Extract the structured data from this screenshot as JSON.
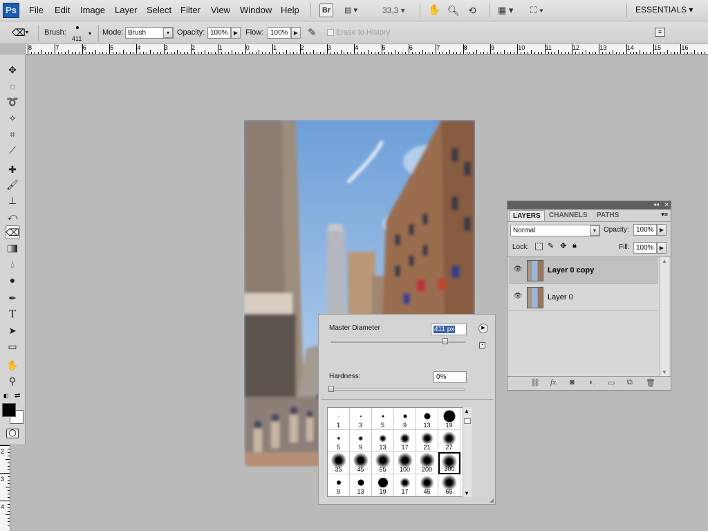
{
  "menubar": {
    "logo": "Ps",
    "items": [
      "File",
      "Edit",
      "Image",
      "Layer",
      "Select",
      "Filter",
      "View",
      "Window",
      "Help"
    ],
    "bridge": "Br",
    "zoom": "33,3",
    "workspace": "ESSENTIALS"
  },
  "options": {
    "brush_label": "Brush:",
    "brush_size": "411",
    "mode_label": "Mode:",
    "mode_value": "Brush",
    "opacity_label": "Opacity:",
    "opacity_value": "100%",
    "flow_label": "Flow:",
    "flow_value": "100%",
    "erase_history": "Erase to History"
  },
  "rulers": {
    "top": [
      "8",
      "7",
      "6",
      "5",
      "4",
      "3",
      "2",
      "1",
      "0",
      "1",
      "2",
      "3",
      "4",
      "5",
      "6",
      "7",
      "8",
      "9",
      "10",
      "11",
      "12",
      "13",
      "14",
      "15",
      "16"
    ],
    "left": [
      "2",
      "3",
      "4"
    ]
  },
  "brush_picker": {
    "master_label": "Master Diameter",
    "master_value": "411 px",
    "master_fraction": 0.85,
    "hardness_label": "Hardness:",
    "hardness_value": "0%",
    "hardness_fraction": 0.0,
    "presets": [
      {
        "n": "1",
        "kind": "hard",
        "d": 1
      },
      {
        "n": "3",
        "kind": "hard",
        "d": 2
      },
      {
        "n": "5",
        "kind": "hard",
        "d": 3
      },
      {
        "n": "9",
        "kind": "hard",
        "d": 5
      },
      {
        "n": "13",
        "kind": "hard",
        "d": 9
      },
      {
        "n": "19",
        "kind": "hard",
        "d": 17
      },
      {
        "n": "5",
        "kind": "soft",
        "d": 4
      },
      {
        "n": "9",
        "kind": "soft",
        "d": 6
      },
      {
        "n": "13",
        "kind": "soft",
        "d": 9
      },
      {
        "n": "17",
        "kind": "soft",
        "d": 12
      },
      {
        "n": "21",
        "kind": "soft",
        "d": 14
      },
      {
        "n": "27",
        "kind": "soft",
        "d": 16
      },
      {
        "n": "35",
        "kind": "soft",
        "d": 18
      },
      {
        "n": "45",
        "kind": "soft",
        "d": 18
      },
      {
        "n": "65",
        "kind": "soft",
        "d": 18
      },
      {
        "n": "100",
        "kind": "soft",
        "d": 18
      },
      {
        "n": "200",
        "kind": "soft",
        "d": 18
      },
      {
        "n": "300",
        "kind": "soft",
        "d": 18
      },
      {
        "n": "9",
        "kind": "hard",
        "d": 6
      },
      {
        "n": "13",
        "kind": "hard",
        "d": 9
      },
      {
        "n": "19",
        "kind": "hard",
        "d": 14
      },
      {
        "n": "17",
        "kind": "soft",
        "d": 12
      },
      {
        "n": "45",
        "kind": "soft",
        "d": 16
      },
      {
        "n": "65",
        "kind": "soft",
        "d": 18
      }
    ],
    "selected_index": 17
  },
  "layers_panel": {
    "tabs": [
      "LAYERS",
      "CHANNELS",
      "PATHS"
    ],
    "blend_mode": "Normal",
    "opacity_label": "Opacity:",
    "opacity_value": "100%",
    "lock_label": "Lock:",
    "fill_label": "Fill:",
    "fill_value": "100%",
    "layers": [
      {
        "name": "Layer 0 copy",
        "selected": true
      },
      {
        "name": "Layer 0",
        "selected": false
      }
    ]
  },
  "colors": {
    "foreground": "#000000",
    "background": "#ffffff"
  }
}
